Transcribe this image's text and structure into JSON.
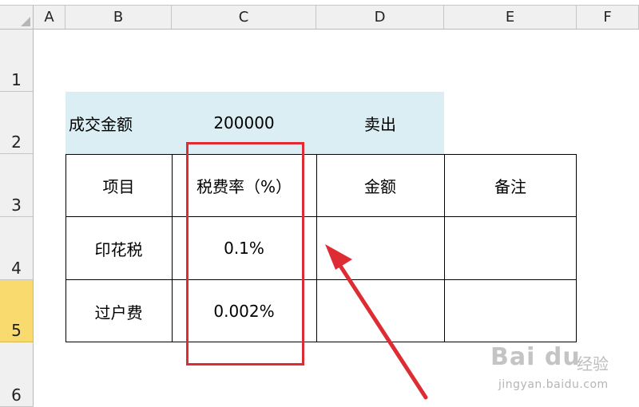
{
  "column_headers": [
    "A",
    "B",
    "C",
    "D",
    "E",
    "F"
  ],
  "row_headers": [
    "1",
    "2",
    "3",
    "4",
    "5",
    "6"
  ],
  "active_row": "5",
  "colors": {
    "header_fill": "#daeef3",
    "highlight_border": "#dd2c33",
    "active_row_header": "#f9da6f"
  },
  "sheet": {
    "row2": {
      "b": "成交金额",
      "c": "200000",
      "d": "卖出"
    },
    "table_headers": [
      "项目",
      "税费率（%）",
      "金额",
      "备注"
    ],
    "rows": [
      {
        "item": "印花税",
        "rate": "0.1%",
        "amount": "",
        "note": ""
      },
      {
        "item": "过户费",
        "rate": "0.002%",
        "amount": "",
        "note": ""
      }
    ]
  },
  "watermark": {
    "logo": "Bai du",
    "brand": "经验",
    "url": "jingyan.baidu.com"
  }
}
